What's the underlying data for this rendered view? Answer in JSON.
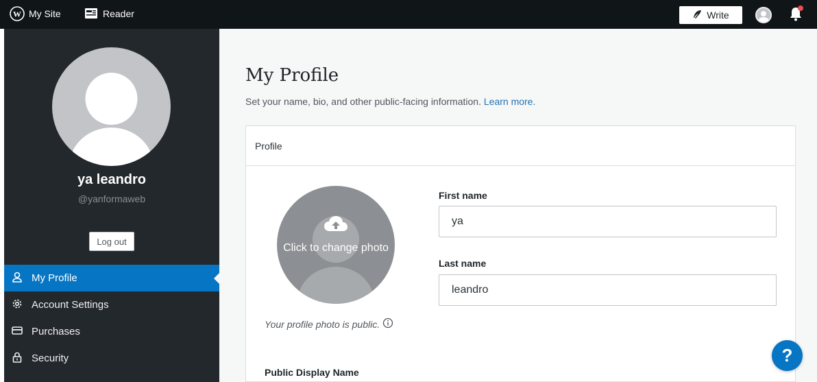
{
  "topbar": {
    "my_site_label": "My Site",
    "reader_label": "Reader",
    "write_label": "Write"
  },
  "sidebar": {
    "display_name": "ya leandro",
    "username": "@yanformaweb",
    "logout_label": "Log out",
    "menu": [
      {
        "label": "My Profile",
        "icon": "person-icon",
        "active": true
      },
      {
        "label": "Account Settings",
        "icon": "gear-icon",
        "active": false
      },
      {
        "label": "Purchases",
        "icon": "credit-card-icon",
        "active": false
      },
      {
        "label": "Security",
        "icon": "lock-icon",
        "active": false
      }
    ]
  },
  "main": {
    "title": "My Profile",
    "subtitle": "Set your name, bio, and other public-facing information.",
    "learn_more": "Learn more.",
    "card": {
      "title": "Profile",
      "photo_cta": "Click to change photo",
      "photo_note": "Your profile photo is public.",
      "first_name_label": "First name",
      "first_name_value": "ya",
      "last_name_label": "Last name",
      "last_name_value": "leandro",
      "display_name_label": "Public Display Name"
    }
  },
  "help_label": "?",
  "colors": {
    "accent": "#0675c4",
    "topbar": "#101517",
    "sidebar": "#23282d"
  }
}
